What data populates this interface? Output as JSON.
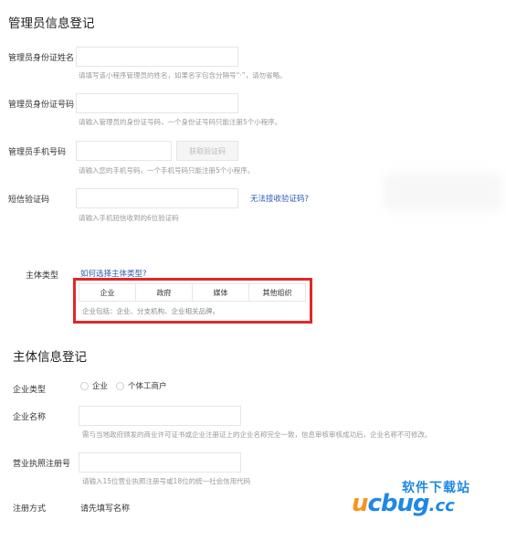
{
  "admin": {
    "title": "管理员信息登记",
    "name_label": "管理员身份证姓名",
    "name_help": "请填写该小程序管理员的姓名，如果名字包含分隔号“·”，请勿省略。",
    "id_label": "管理员身份证号码",
    "id_help": "请输入管理员的身份证号码，一个身份证号码只能注册5个小程序。",
    "phone_label": "管理员手机号码",
    "get_code_button": "获取验证码",
    "phone_help": "请输入您的手机号码，一个手机号码只能注册5个小程序。",
    "sms_label": "短信验证码",
    "sms_link": "无法接收验证码?",
    "sms_help": "请输入手机短信收到的6位验证码"
  },
  "subject_type": {
    "label": "主体类型",
    "how_link": "如何选择主体类型?",
    "options": [
      "企业",
      "政府",
      "媒体",
      "其他组织"
    ],
    "desc": "企业包括：企业、分支机构、企业相关品牌。",
    "highlight_color": "#e02828"
  },
  "subject_info": {
    "title": "主体信息登记",
    "enterprise_type_label": "企业类型",
    "radio_enterprise": "企业",
    "radio_individual": "个体工商户",
    "company_name_label": "企业名称",
    "company_name_help": "需与当地政府颁发的商业许可证书或企业注册证上的企业名称完全一致，信息审核审核成功后，企业名称不可修改。",
    "license_label": "营业执照注册号",
    "license_help": "请输入15位营业执照注册号或18位的统一社会信用代码",
    "register_method_label": "注册方式",
    "register_method_value": "请先填写名称"
  },
  "watermark": {
    "cn": "软件下载站",
    "u": "u",
    "rest": "cbug",
    "cc": ".cc"
  }
}
